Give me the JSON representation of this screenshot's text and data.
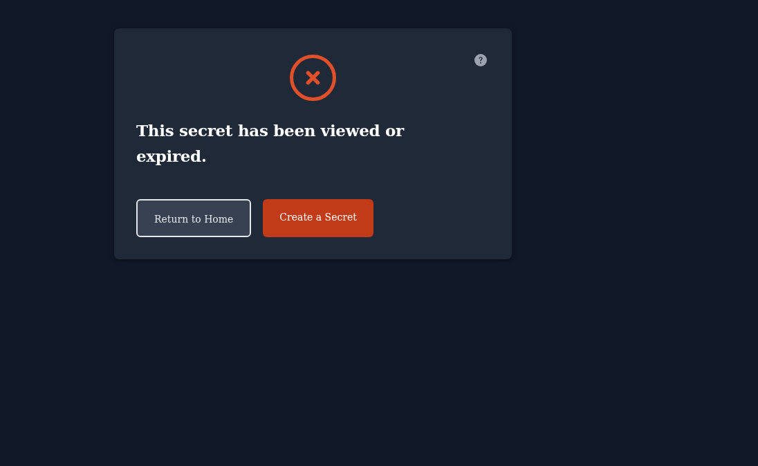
{
  "card": {
    "title": "This secret has been viewed or expired."
  },
  "buttons": [
    {
      "label": "Return to Home",
      "kind": "secondary"
    },
    {
      "label": "Create a Secret",
      "kind": "primary"
    }
  ]
}
